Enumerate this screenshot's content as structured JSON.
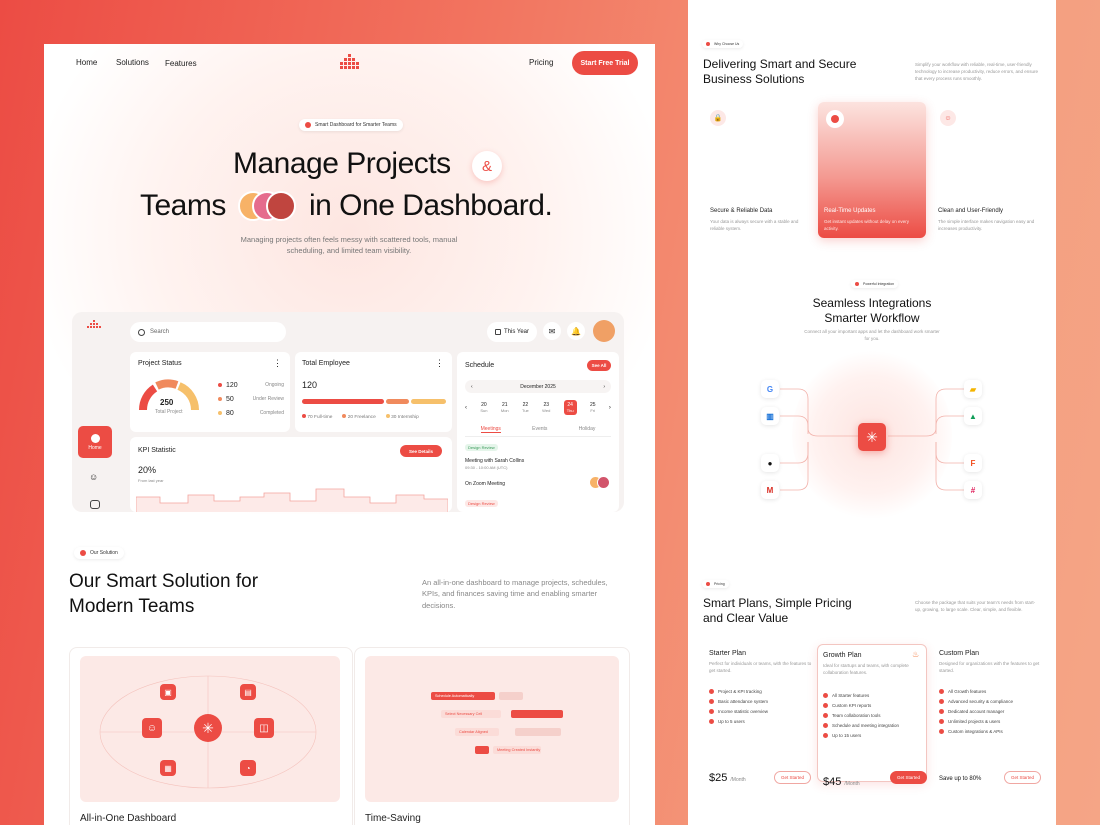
{
  "nav": {
    "home": "Home",
    "solutions": "Solutions",
    "features": "Features",
    "pricing": "Pricing",
    "cta": "Start Free Trial"
  },
  "hero": {
    "badge": "Smart Dashboard for Smarter Teams",
    "line1": "Manage Projects",
    "amp": "&",
    "line2a": "Teams",
    "line2b": "in One Dashboard.",
    "subtitle1": "Managing projects often feels messy with scattered tools, manual",
    "subtitle2": "scheduling, and limited team visibility."
  },
  "dashboard": {
    "search_placeholder": "Search",
    "period": "This Year",
    "sidebar_home": "Home",
    "project_status": {
      "title": "Project Status",
      "total": "250",
      "total_label": "Total Project",
      "rows": [
        {
          "value": "120",
          "label": "Ongoing",
          "color": "#ec4c44"
        },
        {
          "value": "50",
          "label": "Under Review",
          "color": "#f08a5d"
        },
        {
          "value": "80",
          "label": "Completed",
          "color": "#f6c06b"
        }
      ]
    },
    "total_employee": {
      "title": "Total Employee",
      "value": "120",
      "legend": [
        {
          "label": "70 Full-time",
          "color": "#ec4c44"
        },
        {
          "label": "20 Freelance",
          "color": "#f08a5d"
        },
        {
          "label": "30 Internship",
          "color": "#f6c06b"
        }
      ]
    },
    "schedule": {
      "title": "Schedule",
      "see_all": "See All",
      "month": "December 2025",
      "days": [
        {
          "n": "20",
          "d": "Sun"
        },
        {
          "n": "21",
          "d": "Mon"
        },
        {
          "n": "22",
          "d": "Tue"
        },
        {
          "n": "23",
          "d": "Wed"
        },
        {
          "n": "24",
          "d": "Thu"
        },
        {
          "n": "25",
          "d": "Fri"
        }
      ],
      "tabs": [
        "Meetings",
        "Events",
        "Holiday"
      ],
      "tag1": "Design Review",
      "meeting": "Meeting with Sarah Collins",
      "time": "09:30 - 10:00 AM (UTC)",
      "zoom": "On Zoom Meeting",
      "tag2": "Design Review"
    },
    "kpi": {
      "title": "KPI Statistic",
      "btn": "See Details",
      "value": "20%",
      "note": "From last year"
    }
  },
  "solution": {
    "badge": "Our Solution",
    "title1": "Our Smart Solution for",
    "title2": "Modern Teams",
    "desc1": "An all-in-one dashboard to manage projects, schedules,",
    "desc2": "KPIs, and finances saving time and enabling smarter",
    "desc3": "decisions.",
    "card1": "All-in-One Dashboard",
    "card2": "Time-Saving",
    "gantt": [
      "Schedule Automatically",
      "Select Necessary Cell",
      "Calendar Aligned",
      "Meeting Created Instantly"
    ]
  },
  "why": {
    "badge": "Why Choose Us",
    "title1": "Delivering Smart and Secure",
    "title2": "Business Solutions",
    "desc": "Simplify your workflow with reliable, real-time, user-friendly technology to increase productivity, reduce errors, and ensure that every process runs smoothly.",
    "cards": [
      {
        "title": "Secure & Reliable Data",
        "desc": "Your data is always secure with a stable and reliable system."
      },
      {
        "title": "Real-Time Updates",
        "desc": "Get instant updates without delay on every activity."
      },
      {
        "title": "Clean and User-Friendly",
        "desc": "The simple interface makes navigation easy and increases productivity."
      }
    ]
  },
  "integration": {
    "badge": "Powerful Integration",
    "title1": "Seamless Integrations",
    "title2": "Smarter Workflow",
    "desc": "Connect all your important apps and let the dashboard work smarter for you."
  },
  "pricing": {
    "badge": "Pricing",
    "title1": "Smart Plans, Simple Pricing",
    "title2": "and Clear Value",
    "desc": "Choose the package that suits your team's needs from start-up, growing, to large scale. Clear, simple, and flexible.",
    "plans": [
      {
        "name": "Starter Plan",
        "desc": "Perfect for individuals or teams, with the features to get started.",
        "features": [
          "Project & KPI tracking",
          "Basic attendance system",
          "Income statistic overview",
          "Up to 5 users"
        ],
        "price": "$25",
        "per": "/Month",
        "btn": "Get Started"
      },
      {
        "name": "Growth Plan",
        "desc": "Ideal for startups and teams, with complete collaboration features.",
        "features": [
          "All Starter features",
          "Custom KPI reports",
          "Team collaboration tools",
          "Schedule and meeting integration",
          "Up to 15 users"
        ],
        "price": "$45",
        "per": "/Month",
        "btn": "Get Started"
      },
      {
        "name": "Custom Plan",
        "desc": "Designed for organizations with the features to get started.",
        "features": [
          "All Growth features",
          "Advanced security & compliance",
          "Dedicated account manager",
          "Unlimited projects & users",
          "Custom integrations & APIs"
        ],
        "price": "Save up to 80%",
        "per": "",
        "btn": "Get Started"
      }
    ]
  }
}
